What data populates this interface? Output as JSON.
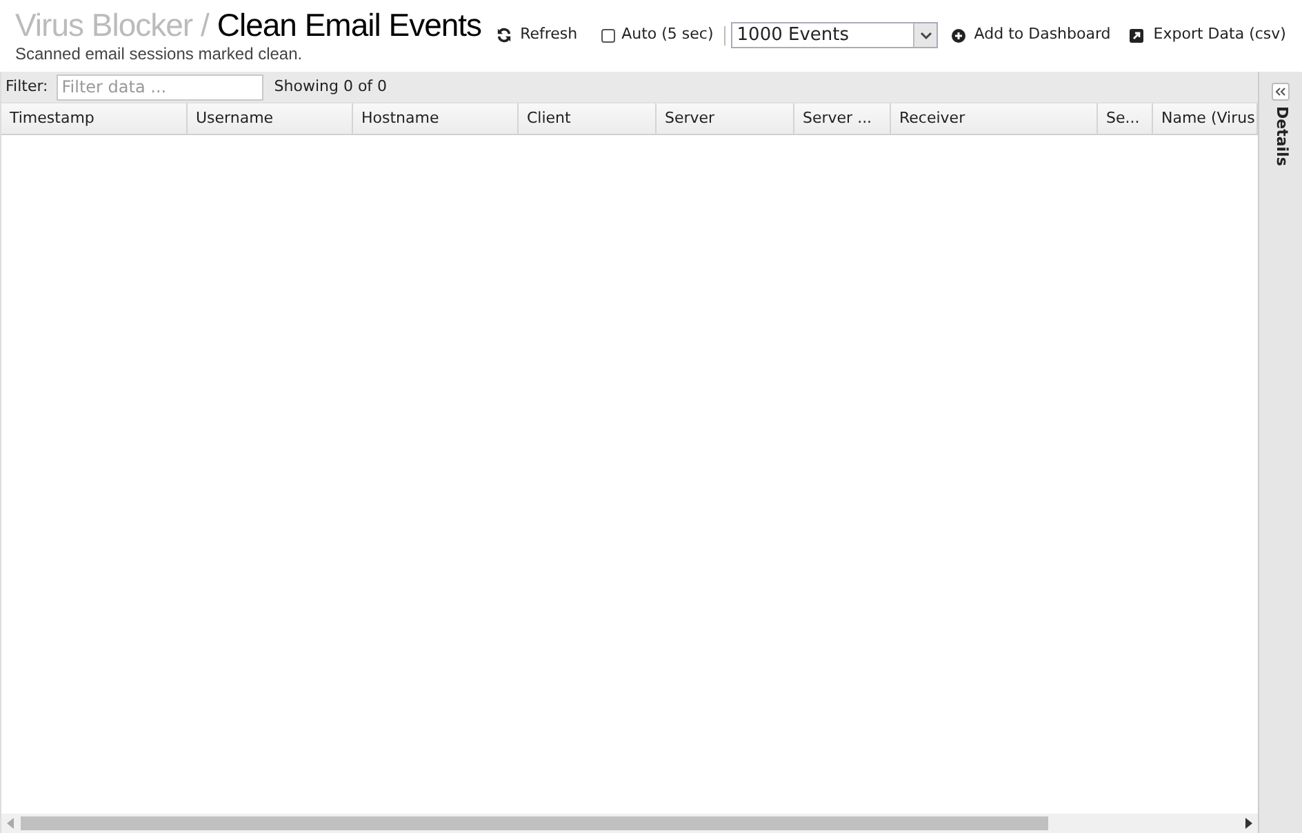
{
  "title": {
    "app": "Virus Blocker /",
    "page": "Clean Email Events"
  },
  "subtitle": "Scanned email sessions marked clean.",
  "toolbar": {
    "refresh": "Refresh",
    "auto": {
      "label": "Auto (5 sec)",
      "checked": false
    },
    "limit": "1000 Events",
    "add": "Add to Dashboard",
    "export": "Export Data (csv)"
  },
  "filter": {
    "label": "Filter:",
    "placeholder": "Filter data ...",
    "count": "Showing 0 of 0"
  },
  "table": {
    "columns": [
      "Timestamp",
      "Username",
      "Hostname",
      "Client",
      "Server",
      "Server ...",
      "Receiver",
      "Se...",
      "Name (Virus"
    ]
  },
  "details": {
    "label": "Details"
  }
}
